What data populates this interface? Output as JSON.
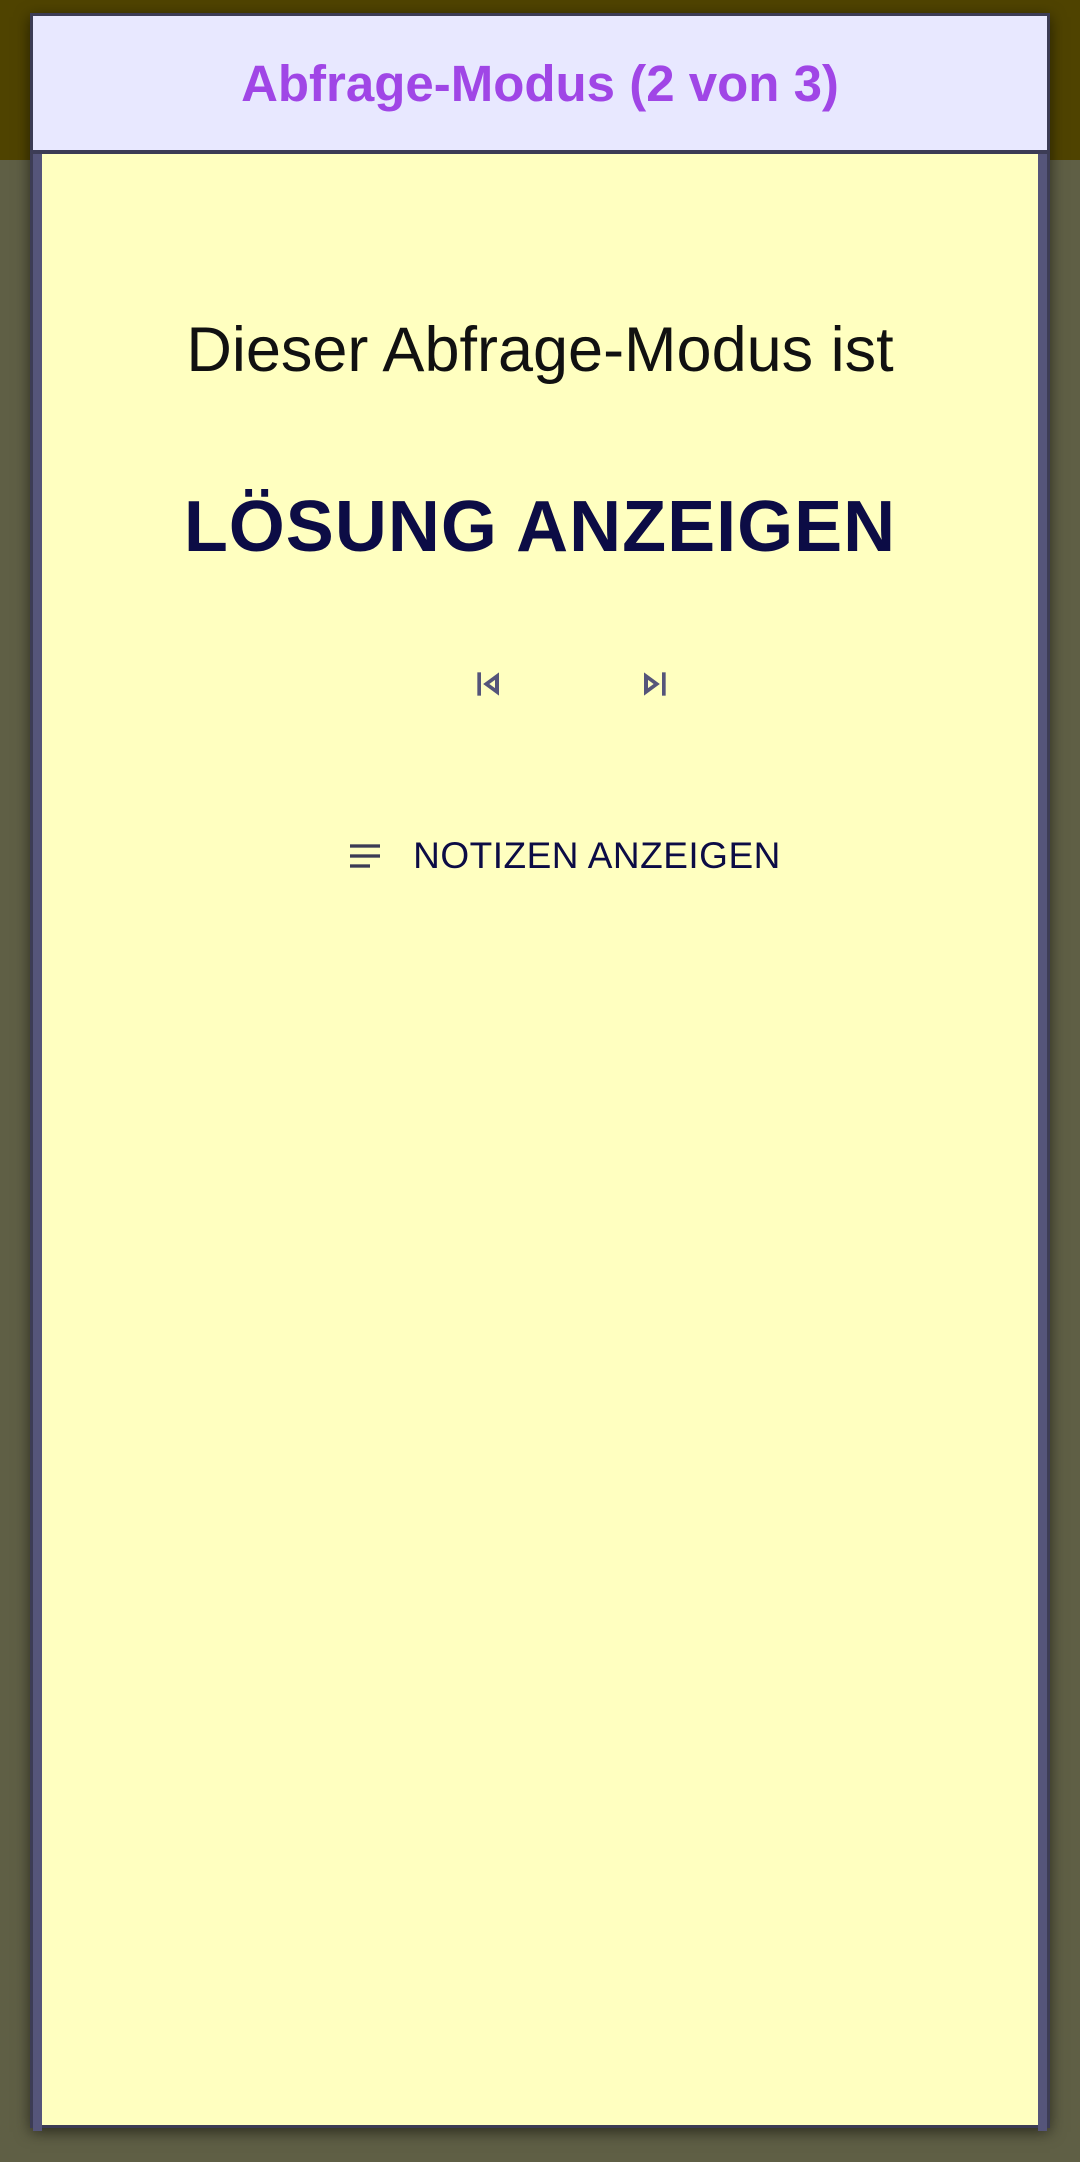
{
  "dialog": {
    "title": "Abfrage-Modus (2 von 3)",
    "intro": "Dieser Abfrage-Modus ist",
    "mode_name": "LÖSUNG ANZEIGEN"
  },
  "navigation": {
    "previous_icon": "skip-previous-icon",
    "next_icon": "skip-next-icon"
  },
  "notes": {
    "icon": "notes-icon",
    "label": "NOTIZEN ANZEIGEN"
  },
  "colors": {
    "title": "#a046e6",
    "header_bg": "#e8e8ff",
    "body_bg": "#ffffc0",
    "text_dark": "#0c0c45",
    "icon": "#55557a"
  }
}
